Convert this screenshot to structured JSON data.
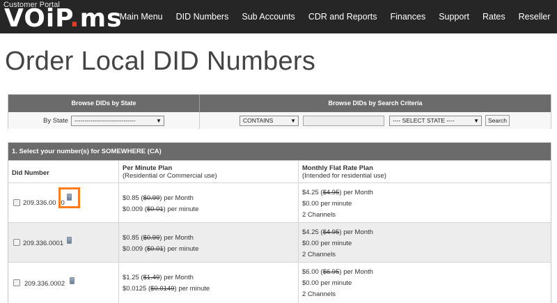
{
  "header": {
    "logo_subtitle": "Customer Portal",
    "logo_text_a": "VOiP",
    "logo_dot": ".",
    "logo_text_b": "ms",
    "nav": [
      "Main Menu",
      "DID Numbers",
      "Sub Accounts",
      "CDR and Reports",
      "Finances",
      "Support",
      "Rates",
      "Reseller"
    ]
  },
  "page_title": "Order Local DID Numbers",
  "browse": {
    "state_header": "Browse DIDs by State",
    "criteria_header": "Browse DIDs by Search Criteria",
    "by_state_label": "By State",
    "state_select_value": "-------------------------------",
    "criteria_select_value": "CONTAINS",
    "search_value": "",
    "state_filter_value": "---- SELECT STATE ----",
    "search_button": "Search"
  },
  "results": {
    "section_title": "1. Select your number(s) for SOMEWHERE (CA)",
    "col_did": "Did Number",
    "col_per_minute_title": "Per Minute Plan",
    "col_per_minute_sub": "(Residential or Commercial use)",
    "col_flat_title": "Monthly Flat Rate Plan",
    "col_flat_sub": "(Intended for residential use)",
    "rows": [
      {
        "number": "209.336.00",
        "number_suffix": "0",
        "pm_month_price": "$0.85",
        "pm_month_old": "$0.99",
        "pm_month_unit": "per Month",
        "pm_minute_price": "$0.009",
        "pm_minute_old": "$0.01",
        "pm_minute_unit": "per minute",
        "flat_month_price": "$4.25",
        "flat_month_old": "$4.95",
        "flat_month_unit": "per Month",
        "flat_minute": "$0.00 per minute",
        "flat_channels": "2 Channels"
      },
      {
        "number": "209.336.0001",
        "pm_month_price": "$0.85",
        "pm_month_old": "$0.99",
        "pm_month_unit": "per Month",
        "pm_minute_price": "$0.009",
        "pm_minute_old": "$0.01",
        "pm_minute_unit": "per minute",
        "flat_month_price": "$4.25",
        "flat_month_old": "$4.95",
        "flat_month_unit": "per Month",
        "flat_minute": "$0.00 per minute",
        "flat_channels": "2 Channels"
      },
      {
        "number": "209.336.0002",
        "pm_month_price": "$1.25",
        "pm_month_old": "$1.49",
        "pm_month_unit": "per Month",
        "pm_minute_price": "$0.0125",
        "pm_minute_old": "$0.0149",
        "pm_minute_unit": "per minute",
        "flat_month_price": "$6.00",
        "flat_month_old": "$6.95",
        "flat_month_unit": "per Month",
        "flat_minute": "$0.00 per minute",
        "flat_channels": "2 Channels"
      }
    ]
  },
  "colors": {
    "topbar": "#262626",
    "brand_accent": "#e03a2a",
    "table_header": "#6b6b6b",
    "highlight": "#ff7a1a"
  },
  "icons": [
    "phone-icon",
    "dropdown-arrow-icon"
  ]
}
